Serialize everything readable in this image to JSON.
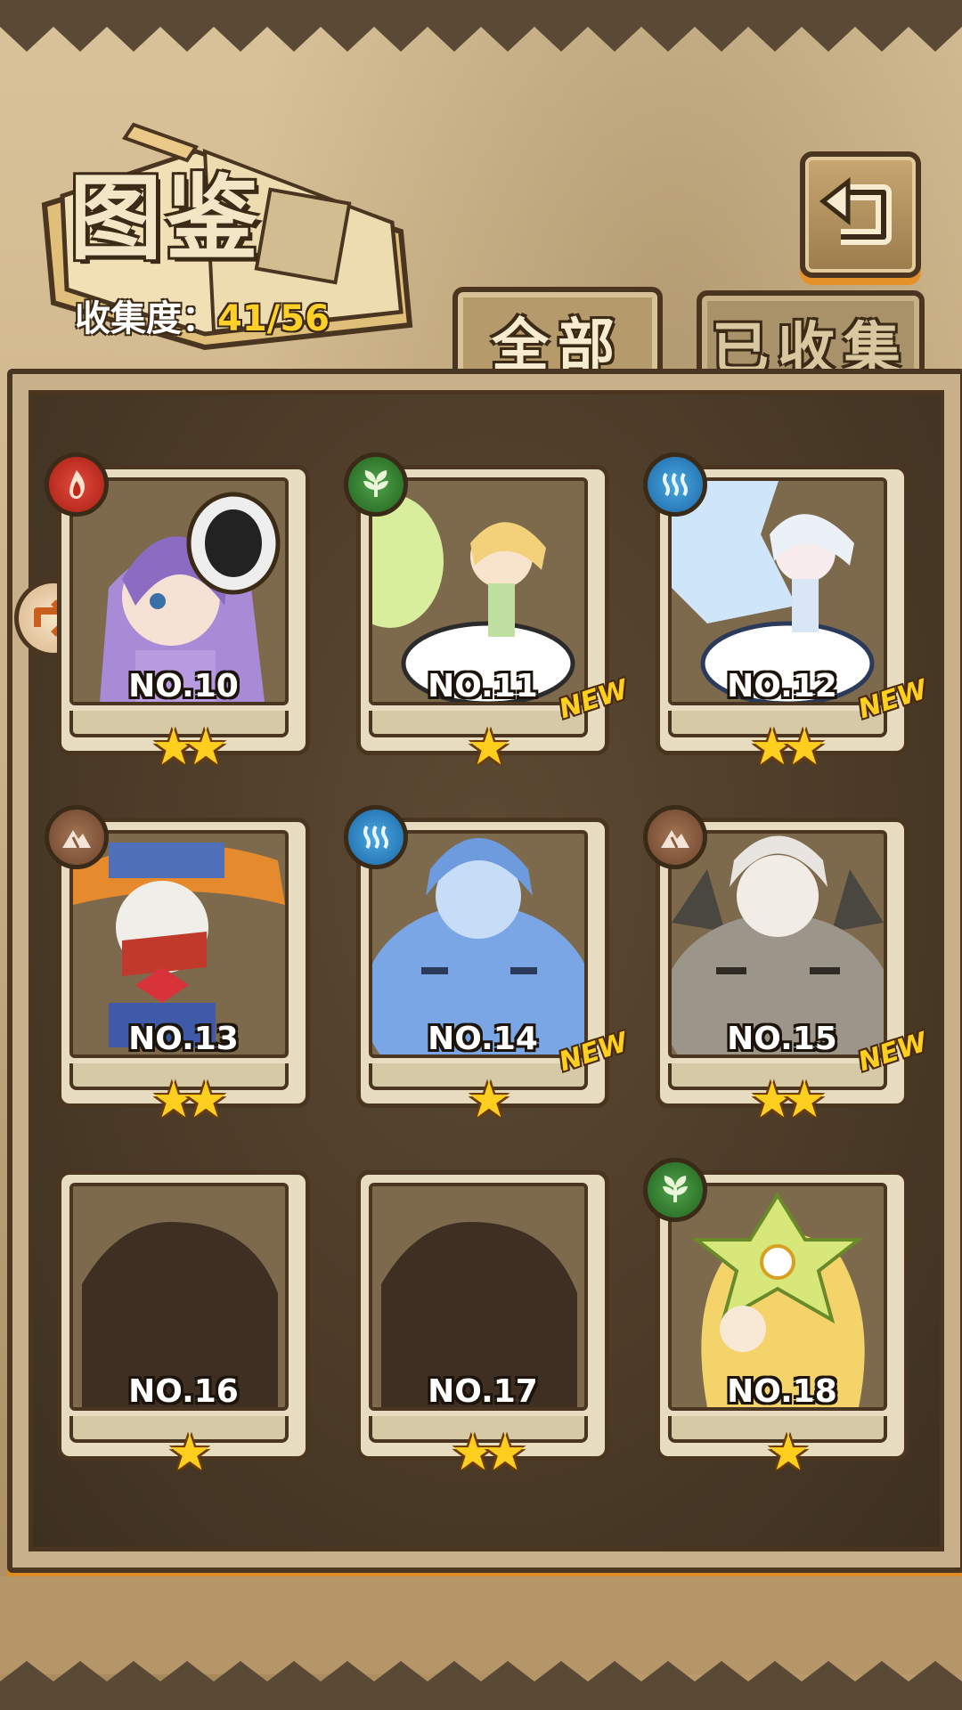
{
  "header": {
    "title": "图鉴",
    "collection_label": "收集度：",
    "collection_value": "41/56"
  },
  "tabs": [
    {
      "label": "全部",
      "selected": true
    },
    {
      "label": "已收集",
      "selected": false
    }
  ],
  "cards": [
    {
      "number": "NO.10",
      "stars": 2,
      "element": "fire-icon",
      "is_new": false,
      "silhouette": false,
      "portrait": "purple"
    },
    {
      "number": "NO.11",
      "stars": 1,
      "element": "grass-icon",
      "is_new": true,
      "silhouette": false,
      "portrait": "sprout"
    },
    {
      "number": "NO.12",
      "stars": 2,
      "element": "water-icon",
      "is_new": true,
      "silhouette": false,
      "portrait": "snowflower"
    },
    {
      "number": "NO.13",
      "stars": 2,
      "element": "earth-icon",
      "is_new": false,
      "silhouette": false,
      "portrait": "scarecrow"
    },
    {
      "number": "NO.14",
      "stars": 1,
      "element": "water-icon",
      "is_new": true,
      "silhouette": false,
      "portrait": "blueslime"
    },
    {
      "number": "NO.15",
      "stars": 2,
      "element": "earth-icon",
      "is_new": true,
      "silhouette": false,
      "portrait": "greyslime"
    },
    {
      "number": "NO.16",
      "stars": 1,
      "element": "",
      "is_new": false,
      "silhouette": true,
      "portrait": "shadow"
    },
    {
      "number": "NO.17",
      "stars": 2,
      "element": "",
      "is_new": false,
      "silhouette": true,
      "portrait": "shadow"
    },
    {
      "number": "NO.18",
      "stars": 1,
      "element": "grass-icon",
      "is_new": false,
      "silhouette": false,
      "portrait": "flower"
    }
  ],
  "new_badge": "NEW",
  "colors": {
    "accent_orange": "#e08a26",
    "collect_yellow": "#ffd128",
    "frame_dark": "#4a3520"
  }
}
